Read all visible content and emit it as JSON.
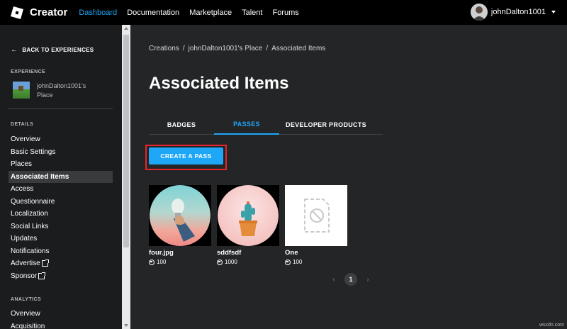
{
  "nav": {
    "brand": "Creator",
    "links": [
      "Dashboard",
      "Documentation",
      "Marketplace",
      "Talent",
      "Forums"
    ],
    "active": "Dashboard",
    "username": "johnDalton1001",
    "accent": "#1fa7f7"
  },
  "sidebar": {
    "back_label": "BACK TO EXPERIENCES",
    "experience_label": "EXPERIENCE",
    "experience_name": "johnDalton1001's Place",
    "details_label": "DETAILS",
    "details_items": [
      {
        "label": "Overview",
        "external": false
      },
      {
        "label": "Basic Settings",
        "external": false
      },
      {
        "label": "Places",
        "external": false
      },
      {
        "label": "Associated Items",
        "external": false,
        "active": true
      },
      {
        "label": "Access",
        "external": false
      },
      {
        "label": "Questionnaire",
        "external": false
      },
      {
        "label": "Localization",
        "external": false
      },
      {
        "label": "Social Links",
        "external": false
      },
      {
        "label": "Updates",
        "external": false
      },
      {
        "label": "Notifications",
        "external": false
      },
      {
        "label": "Advertise",
        "external": true
      },
      {
        "label": "Sponsor",
        "external": true
      }
    ],
    "analytics_label": "ANALYTICS",
    "analytics_items": [
      "Overview",
      "Acquisition"
    ]
  },
  "main": {
    "breadcrumb": [
      "Creations",
      "/",
      "johnDalton1001's Place",
      "/",
      "Associated Items"
    ],
    "title": "Associated Items",
    "tabs": [
      {
        "label": "BADGES"
      },
      {
        "label": "PASSES",
        "active": true
      },
      {
        "label": "DEVELOPER PRODUCTS"
      }
    ],
    "create_button": "CREATE A PASS",
    "highlight_color": "#e8242a",
    "passes": [
      {
        "name": "four.jpg",
        "price": "100",
        "thumb": "lightbulb-photo"
      },
      {
        "name": "sddfsdf",
        "price": "1000",
        "thumb": "cactus-photo"
      },
      {
        "name": "One",
        "price": "100",
        "thumb": "unavailable-placeholder"
      }
    ],
    "pagination": {
      "current": "1",
      "prev": "‹",
      "next": "›"
    }
  },
  "watermark": "wsxdn.com"
}
